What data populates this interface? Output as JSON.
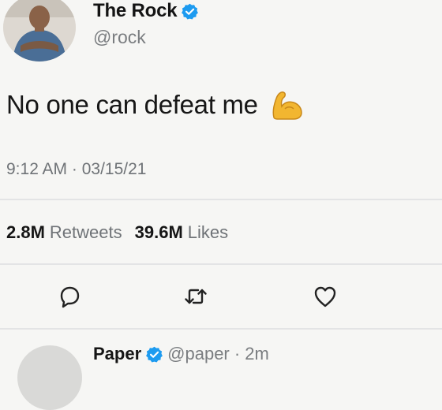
{
  "tweet": {
    "display_name": "The Rock",
    "handle": "@rock",
    "text": "No one can defeat me",
    "emoji": "flexed-biceps",
    "timestamp": "9:12 AM · 03/15/21",
    "stats": {
      "retweets_count": "2.8M",
      "retweets_label": "Retweets",
      "likes_count": "39.6M",
      "likes_label": "Likes"
    },
    "actions": [
      "reply-icon",
      "retweet-icon",
      "like-icon"
    ]
  },
  "next_tweet": {
    "display_name": "Paper",
    "handle_time": "@paper · 2m"
  },
  "colors": {
    "background": "#f6f6f4",
    "verified": "#1d9bf0",
    "muted_text": "#6f7377",
    "divider": "#e3e4e5"
  }
}
